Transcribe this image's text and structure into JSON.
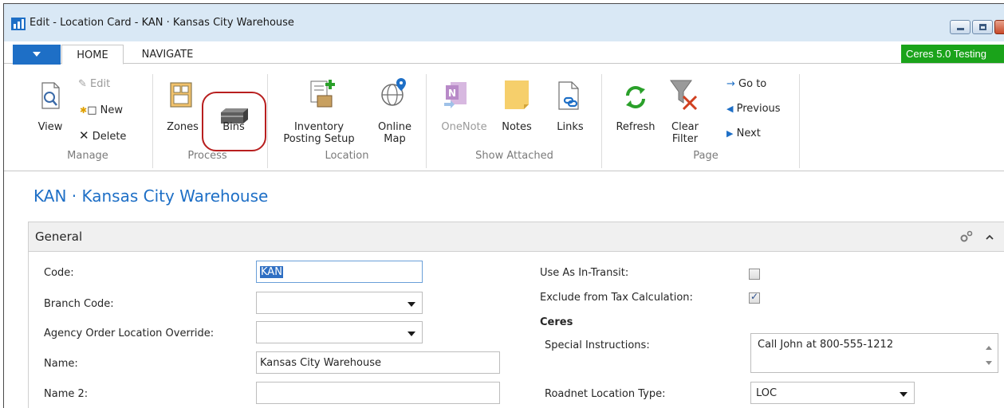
{
  "window": {
    "title": "Edit - Location Card - KAN · Kansas City Warehouse"
  },
  "ribbon": {
    "tabs": [
      {
        "label": "HOME",
        "active": true
      },
      {
        "label": "NAVIGATE",
        "active": false
      }
    ],
    "badge": "Ceres 5.0 Testing",
    "groups": {
      "manage": {
        "label": "Manage",
        "view": "View",
        "edit": "Edit",
        "new": "New",
        "delete": "Delete"
      },
      "process": {
        "label": "Process",
        "zones": "Zones",
        "bins": "Bins"
      },
      "location": {
        "label": "Location",
        "inventory_posting_setup_line1": "Inventory",
        "inventory_posting_setup_line2": "Posting Setup",
        "online_map_line1": "Online",
        "online_map_line2": "Map"
      },
      "show_attached": {
        "label": "Show Attached",
        "onenote": "OneNote",
        "notes": "Notes",
        "links": "Links"
      },
      "page": {
        "label": "Page",
        "refresh": "Refresh",
        "clear_filter_line1": "Clear",
        "clear_filter_line2": "Filter",
        "go_to": "Go to",
        "previous": "Previous",
        "next": "Next"
      }
    }
  },
  "page_title": "KAN · Kansas City Warehouse",
  "general": {
    "label": "General",
    "fields_left": {
      "code_label": "Code:",
      "code_value": "KAN",
      "branch_code_label": "Branch Code:",
      "branch_code_value": "",
      "agency_override_label": "Agency Order Location Override:",
      "agency_override_value": "",
      "name_label": "Name:",
      "name_value": "Kansas City Warehouse",
      "name2_label": "Name 2:",
      "name2_value": ""
    },
    "fields_right": {
      "in_transit_label": "Use As In-Transit:",
      "in_transit_checked": false,
      "exclude_tax_label": "Exclude from Tax Calculation:",
      "exclude_tax_checked": true,
      "ceres_heading": "Ceres",
      "special_instructions_label": "Special Instructions:",
      "special_instructions_value": "Call John at 800-555-1212",
      "roadnet_type_label": "Roadnet Location Type:",
      "roadnet_type_value": "LOC"
    }
  },
  "colors": {
    "accent_blue": "#1e6fc6",
    "badge_green": "#1aa31a",
    "highlight_red": "#b81f1f"
  }
}
